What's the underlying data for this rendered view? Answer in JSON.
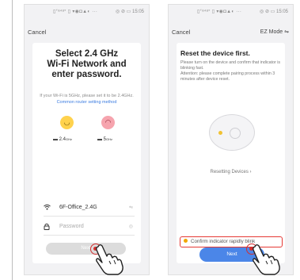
{
  "screen1": {
    "status_left": "▯ᐪᵃ⁴ᵃᐤ ▯ ▾◉◘▲◐ ···",
    "status_right": "◎ ⊘ ▭ 15:05",
    "cancel": "Cancel",
    "title_line1": "Select 2.4 GHz",
    "title_line2": "Wi-Fi Network and",
    "title_line3": "enter password.",
    "note_prefix": "If your Wi-Fi is 5GHz, please set it to be 2.4GHz.",
    "note_link": "Common router setting method",
    "band_ok": "2.4",
    "band_ok_unit": "GHz",
    "band_bad": "5",
    "band_bad_unit": "GHz",
    "ssid": "6F-Office_2.4G",
    "ssid_end": "⇋",
    "password_placeholder": "Password",
    "password_end": "◎",
    "next_label": "Next"
  },
  "screen2": {
    "status_left": "▯ᐪᵃ⁴ᵃᐤ ▯ ▾◉◘▲◐ ···",
    "status_right": "◎ ⊘ ▭ 15:05",
    "cancel": "Cancel",
    "ez_mode": "EZ Mode ⇋",
    "title": "Reset the device first.",
    "desc": "Please turn on the device and confirm that indicator is blinking fast.\nAttention: please complete pairing process within 3 minutes after device reset.",
    "reset_link": "Resetting Devices ›",
    "confirm": "Confirm indicator rapidly blink",
    "next_label": "Next"
  },
  "icons": {
    "wifi": "wifi-icon",
    "lock": "lock-icon",
    "router": "router-icon",
    "smile": "smiley-face-icon",
    "frown": "sad-face-icon",
    "hand": "tapping-hand-icon"
  },
  "colors": {
    "accent_blue": "#4b86e8",
    "link_blue": "#3a7be0",
    "highlight_red": "#e53935",
    "indicator_yellow": "#f1c232"
  }
}
